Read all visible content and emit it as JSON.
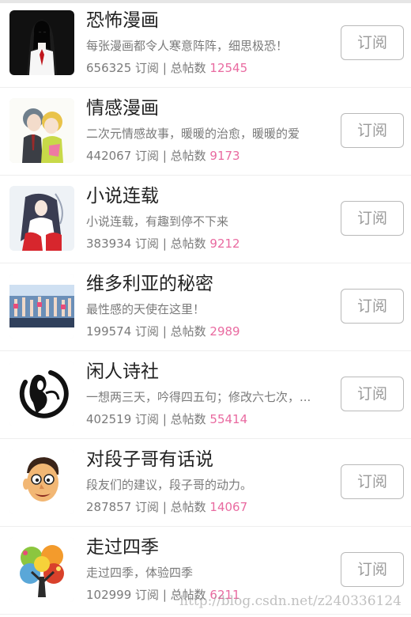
{
  "subscribe_label": "订阅",
  "stats_sep": " | 总帖数 ",
  "stats_unit": " 订阅",
  "accent": "#e96aa0",
  "watermark": "http://blog.csdn.net/z240336124",
  "items": [
    {
      "title": "恐怖漫画",
      "desc": "每张漫画都令人寒意阵阵，细思极恐！",
      "subscribers": "656325",
      "posts": "12545",
      "icon": "horror-comic-thumbnail"
    },
    {
      "title": "情感漫画",
      "desc": "二次元情感故事，暖暖的治愈，暖暖的爱",
      "subscribers": "442067",
      "posts": "9173",
      "icon": "romance-comic-thumbnail"
    },
    {
      "title": "小说连载",
      "desc": "小说连载，有趣到停不下来",
      "subscribers": "383934",
      "posts": "9212",
      "icon": "novel-thumbnail"
    },
    {
      "title": "维多利亚的秘密",
      "desc": "最性感的天使在这里！",
      "subscribers": "199574",
      "posts": "2989",
      "icon": "fashion-show-thumbnail"
    },
    {
      "title": "闲人诗社",
      "desc": "一想两三天，吟得四五句；修改六七次，...",
      "subscribers": "402519",
      "posts": "55414",
      "icon": "poetry-club-thumbnail"
    },
    {
      "title": "对段子哥有话说",
      "desc": "段友们的建议，段子哥的动力。",
      "subscribers": "287857",
      "posts": "14067",
      "icon": "cartoon-face-thumbnail"
    },
    {
      "title": "走过四季",
      "desc": "走过四季，体验四季",
      "subscribers": "102999",
      "posts": "6211",
      "icon": "four-seasons-tree-thumbnail"
    }
  ]
}
